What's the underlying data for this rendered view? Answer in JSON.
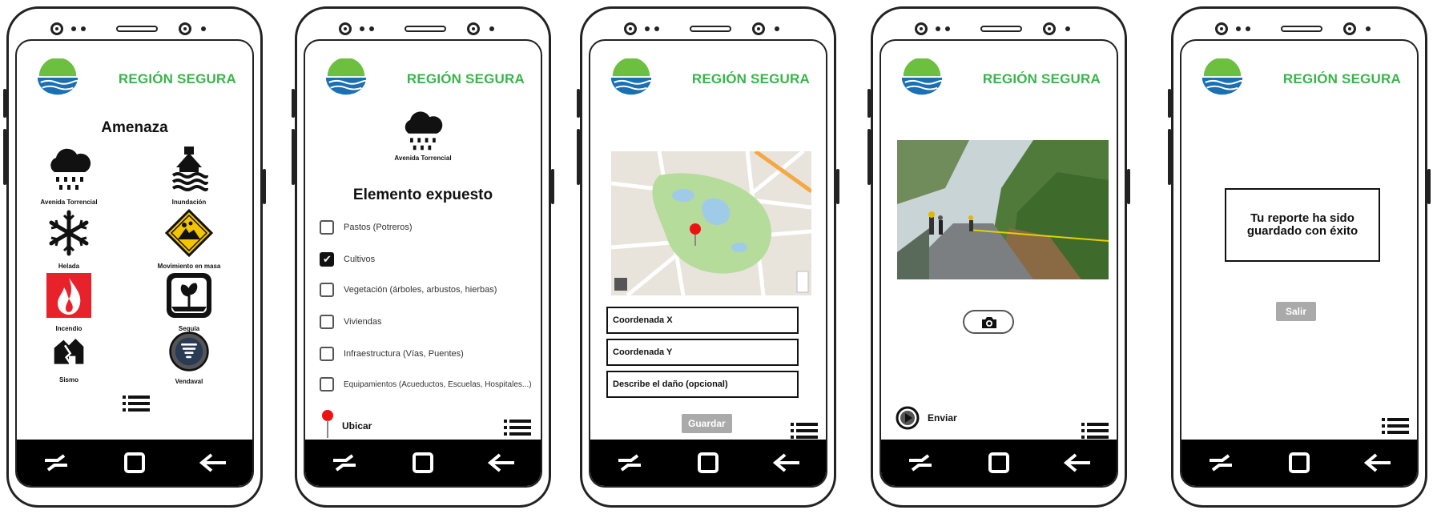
{
  "brand": "REGIÓN SEGURA",
  "screen1": {
    "title": "Amenaza",
    "threats": [
      {
        "label": "Avenida Torrencial",
        "icon": "rain-cloud-icon"
      },
      {
        "label": "Inundación",
        "icon": "flood-house-icon"
      },
      {
        "label": "Helada",
        "icon": "snowflake-icon"
      },
      {
        "label": "Movimiento en masa",
        "icon": "landslide-sign-icon"
      },
      {
        "label": "Incendio",
        "icon": "fire-icon"
      },
      {
        "label": "Sequía",
        "icon": "drought-icon"
      },
      {
        "label": "Sismo",
        "icon": "earthquake-icon"
      },
      {
        "label": "Vendaval",
        "icon": "tornado-icon"
      }
    ]
  },
  "screen2": {
    "selected_threat": "Avenida Torrencial",
    "title": "Elemento expuesto",
    "items": [
      {
        "label": "Pastos (Potreros)",
        "checked": false
      },
      {
        "label": "Cultivos",
        "checked": true
      },
      {
        "label": "Vegetación (árboles, arbustos, hierbas)",
        "checked": false
      },
      {
        "label": "Viviendas",
        "checked": false
      },
      {
        "label": "Infraestructura (Vías, Puentes)",
        "checked": false
      },
      {
        "label": "Equipamientos (Acueductos, Escuelas, Hospitales...)",
        "checked": false
      }
    ],
    "locate_label": "Ubicar"
  },
  "screen3": {
    "field_x": "Coordenada X",
    "field_y": "Coordenada Y",
    "field_desc": "Describe el daño (opcional)",
    "save_label": "Guardar"
  },
  "screen4": {
    "send_label": "Enviar"
  },
  "screen5": {
    "message": "Tu reporte ha sido guardado con éxito",
    "exit_label": "Salir"
  },
  "colors": {
    "brand_green": "#39b54a",
    "logo_blue": "#1b6fb3",
    "logo_orange": "#f7931e",
    "fire_red": "#e8222b",
    "sign_yellow": "#f5c400",
    "button_grey": "#aaaaaa",
    "pin_red": "#ee1111"
  }
}
